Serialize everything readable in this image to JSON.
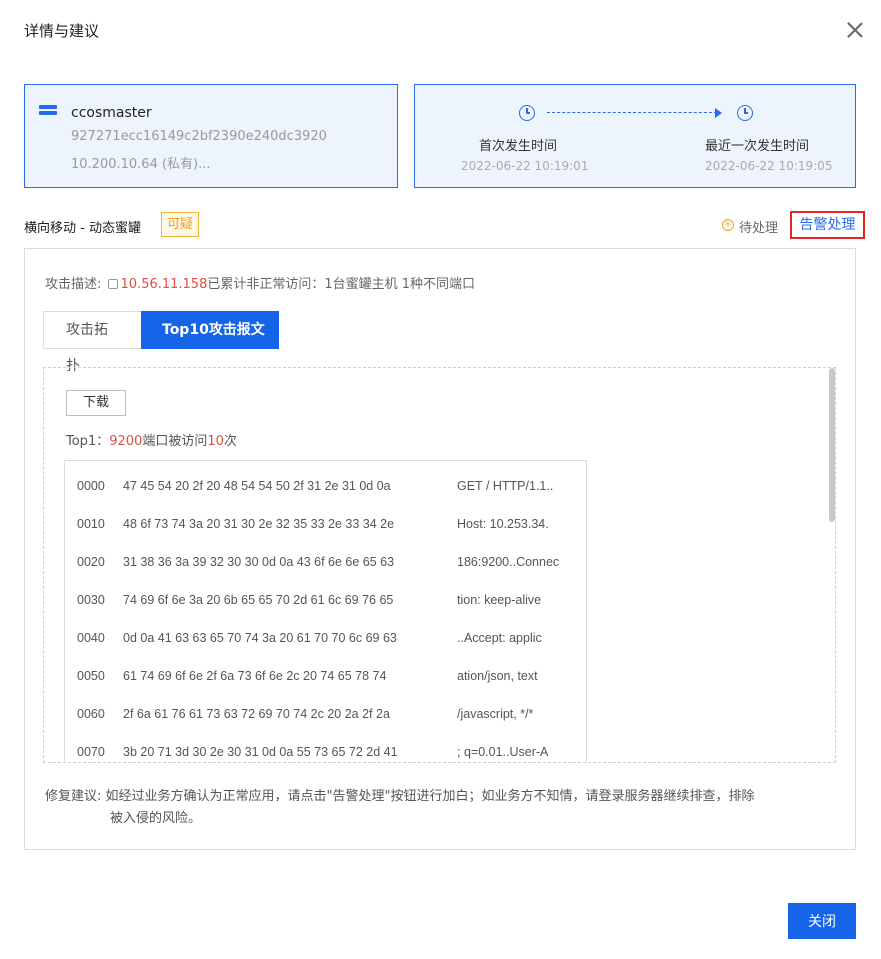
{
  "dialog": {
    "title": "详情与建议"
  },
  "host": {
    "name": "ccosmaster",
    "id": "927271ecc16149c2bf2390e240dc3920",
    "ip": "10.200.10.64 (私有)..."
  },
  "time": {
    "first_label": "首次发生时间",
    "first_value": "2022-06-22 10:19:01",
    "last_label": "最近一次发生时间",
    "last_value": "2022-06-22 10:19:05"
  },
  "event": {
    "title": "横向移动 - 动态蜜罐",
    "badge": "可疑",
    "status_icon": "⑥",
    "status": "待处理",
    "alarm_action": "告警处理"
  },
  "attack": {
    "prefix": "攻击描述: ",
    "ip": "10.56.11.158",
    "suffix": "已累计非正常访问：1台蜜罐主机 1种不同端口"
  },
  "tabs": [
    {
      "label": "攻击拓扑",
      "active": false
    },
    {
      "label": "Top10攻击报文",
      "active": true
    }
  ],
  "report": {
    "download_label": "下载",
    "top1_prefix": "Top1：",
    "top1_port": "9200",
    "top1_mid": "端口被访问",
    "top1_count": "10",
    "top1_suffix": "次",
    "rows": [
      {
        "offset": "0000",
        "hex": "47 45 54 20 2f 20 48 54 54 50 2f 31 2e 31 0d 0a",
        "ascii": "GET / HTTP/1.1.."
      },
      {
        "offset": "0010",
        "hex": "48 6f 73 74 3a 20 31 30 2e 32 35 33 2e 33 34 2e",
        "ascii": "Host: 10.253.34."
      },
      {
        "offset": "0020",
        "hex": "31 38 36 3a 39 32 30 30 0d 0a 43 6f 6e 6e 65 63",
        "ascii": "186:9200..Connec"
      },
      {
        "offset": "0030",
        "hex": "74 69 6f 6e 3a 20 6b 65 65 70 2d 61 6c 69 76 65",
        "ascii": "tion: keep-alive"
      },
      {
        "offset": "0040",
        "hex": "0d 0a 41 63 63 65 70 74 3a 20 61 70 70 6c 69 63",
        "ascii": "..Accept: applic"
      },
      {
        "offset": "0050",
        "hex": "61 74 69 6f 6e 2f 6a 73 6f 6e 2c 20 74 65 78 74",
        "ascii": "ation/json, text"
      },
      {
        "offset": "0060",
        "hex": "2f 6a 61 76 61 73 63 72 69 70 74 2c 20 2a 2f 2a",
        "ascii": "/javascript, */*"
      },
      {
        "offset": "0070",
        "hex": "3b 20 71 3d 30 2e 30 31 0d 0a 55 73 65 72 2d 41",
        "ascii": "; q=0.01..User-A"
      }
    ]
  },
  "advice": {
    "line1": "修复建议: 如经过业务方确认为正常应用，请点击\"告警处理\"按钮进行加白；如业务方不知情，请登录服务器继续排查，排除",
    "line2": "被入侵的风险。"
  },
  "footer": {
    "close_label": "关闭"
  }
}
